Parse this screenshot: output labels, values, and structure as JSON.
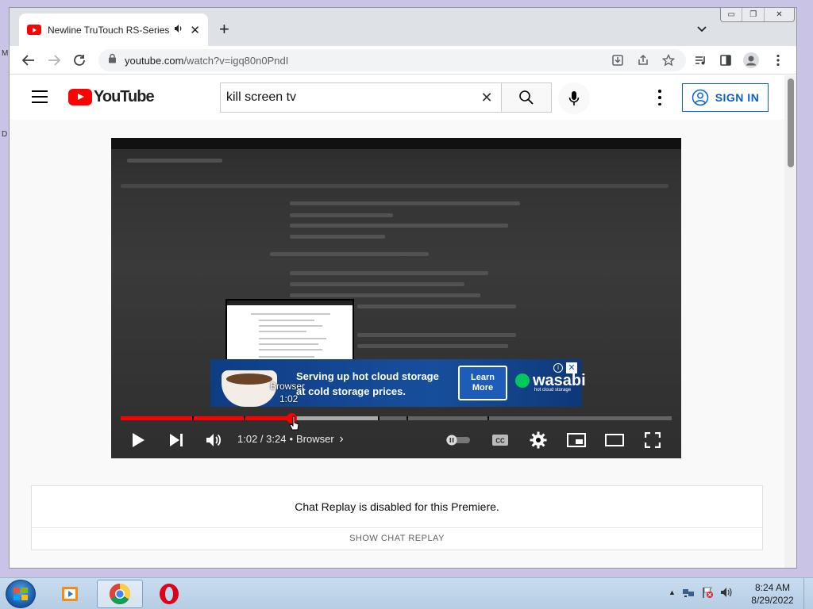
{
  "desktop": {
    "left_letter_1": "M",
    "left_letter_2": "D"
  },
  "browser": {
    "tab": {
      "title": "Newline TruTouch RS-Series",
      "close": "✕"
    },
    "new_tab": "+",
    "url_domain": "youtube.com",
    "url_path": "/watch?v=igq80n0PndI",
    "window_buttons": [
      "▭",
      "❐",
      "✕"
    ]
  },
  "youtube": {
    "logo_text": "YouTube",
    "search": {
      "value": "kill screen tv",
      "clear": "✕"
    },
    "sign_in": "SIGN IN"
  },
  "player": {
    "ad": {
      "line1": "Serving up hot cloud storage",
      "line2": "at cold storage prices.",
      "cta": "Learn More",
      "brand": "wasabi",
      "brand_sub": "hot cloud storage",
      "info": "i",
      "close": "✕"
    },
    "hover_chapter": "Browser",
    "hover_time": "1:02",
    "progress": {
      "played_fraction": 0.31,
      "buffered_fraction": 0.47
    },
    "time_display": "1:02 / 3:24",
    "chapter_sep": "•",
    "chapter": "Browser",
    "chapter_arrow": "›",
    "cc_label": "CC"
  },
  "chat": {
    "message": "Chat Replay is disabled for this Premiere.",
    "button": "SHOW CHAT REPLAY"
  },
  "taskbar": {
    "clock_time": "8:24 AM",
    "clock_date": "8/29/2022",
    "tray_arrow": "▲"
  },
  "colors": {
    "yt_red": "#ff0000",
    "link_blue": "#065fd4",
    "ad_blue": "#174e9c"
  }
}
